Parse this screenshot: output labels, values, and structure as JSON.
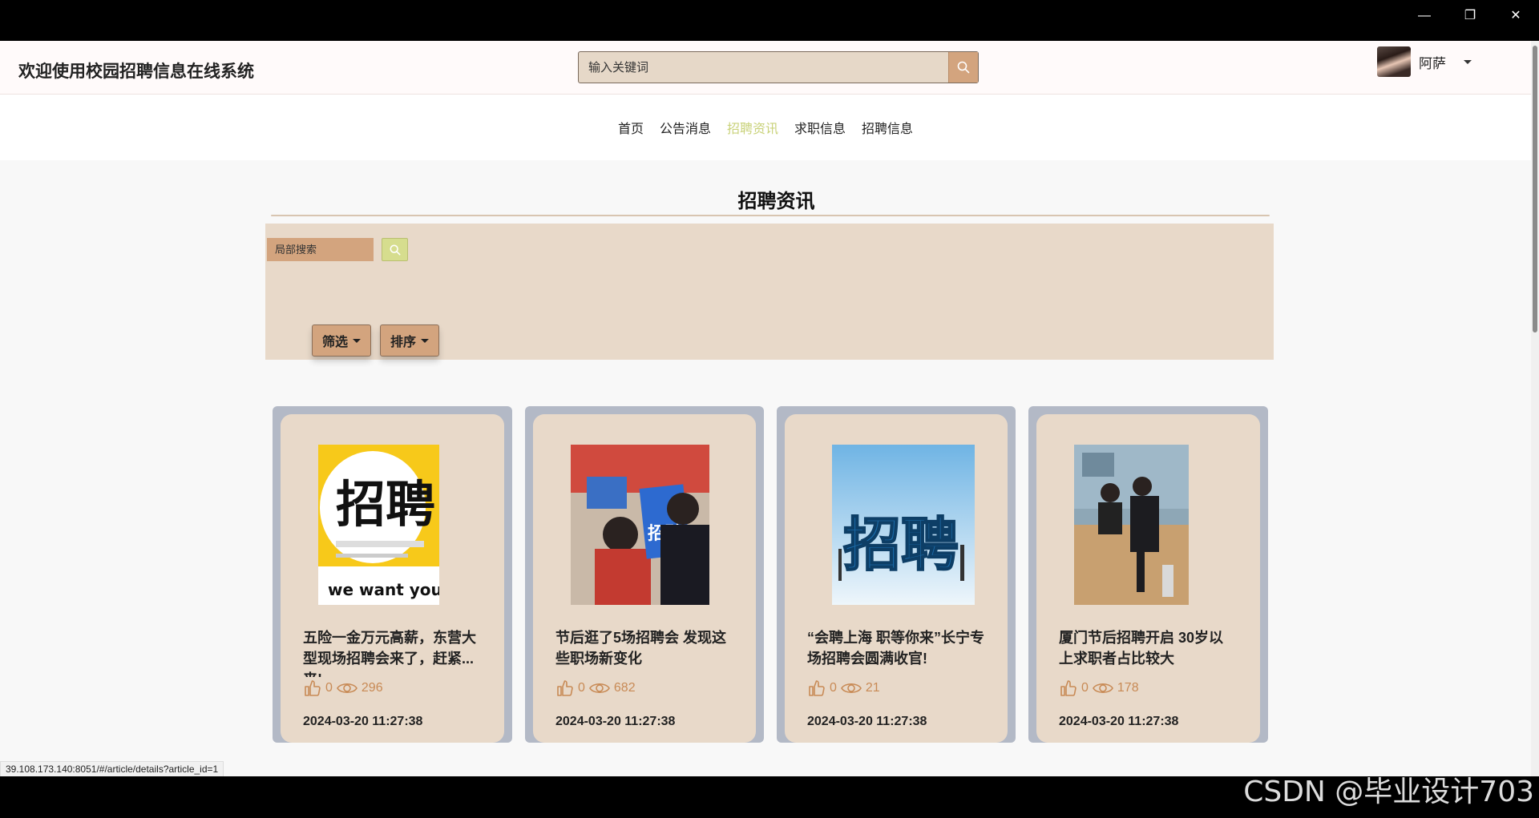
{
  "header": {
    "site_title": "欢迎使用校园招聘信息在线系统",
    "search_placeholder": "输入关键词",
    "user_name": "阿萨"
  },
  "nav": {
    "items": [
      {
        "label": "首页"
      },
      {
        "label": "公告消息"
      },
      {
        "label": "招聘资讯",
        "active": true
      },
      {
        "label": "求职信息"
      },
      {
        "label": "招聘信息"
      }
    ]
  },
  "page": {
    "title": "招聘资讯",
    "local_search_placeholder": "局部搜索",
    "filter_label": "筛选",
    "sort_label": "排序"
  },
  "cards": [
    {
      "title": "五险一金万元高薪，东营大型现场招聘会来了，赶紧...来!",
      "likes": "0",
      "views": "296",
      "date": "2024-03-20 11:27:38",
      "img_text": "招聘",
      "img_sub": "we want you"
    },
    {
      "title": "节后逛了5场招聘会 发现这些职场新变化",
      "likes": "0",
      "views": "682",
      "date": "2024-03-20 11:27:38",
      "img_text": "招聘"
    },
    {
      "title": "“会聘上海 职等你来”长宁专场招聘会圆满收官!",
      "likes": "0",
      "views": "21",
      "date": "2024-03-20 11:27:38",
      "img_text": "招聘"
    },
    {
      "title": "厦门节后招聘开启 30岁以上求职者占比较大",
      "likes": "0",
      "views": "178",
      "date": "2024-03-20 11:27:38"
    }
  ],
  "status_url": "39.108.173.140:8051/#/article/details?article_id=1",
  "watermark": "CSDN @毕业设计703",
  "colors": {
    "accent": "#d3a47e",
    "panel": "#e8d9c9",
    "nav_active": "#c9d27a",
    "stat": "#c88a55"
  }
}
